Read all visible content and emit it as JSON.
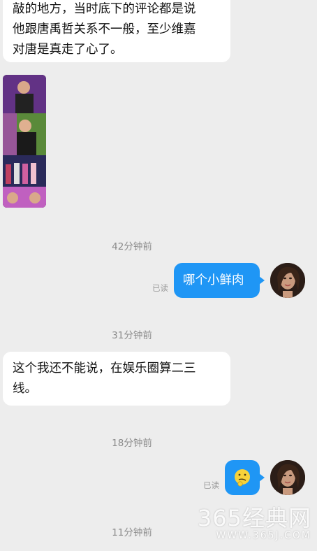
{
  "messages": {
    "first_incoming": {
      "lines": [
        "敲的地方，当时底下的评论都是说",
        "他跟唐禹哲关系不一般，至少维嘉",
        "对唐是真走了心了。"
      ]
    },
    "timestamp_1": "42分钟前",
    "outgoing_1": {
      "text": "哪个小鲜肉",
      "read": "已读"
    },
    "timestamp_2": "31分钟前",
    "second_incoming": {
      "lines": [
        "这个我还不能说，在娱乐圈算二三",
        "线。"
      ]
    },
    "timestamp_3": "18分钟前",
    "outgoing_2": {
      "emoji": "🤔",
      "read": "已读"
    },
    "timestamp_4": "11分钟前"
  },
  "watermark": {
    "main": "365经典网",
    "sub": "WWW.365J.COM"
  },
  "colors": {
    "outgoing_bubble": "#1f96f5",
    "incoming_bubble": "#ffffff",
    "background": "#ededed"
  }
}
